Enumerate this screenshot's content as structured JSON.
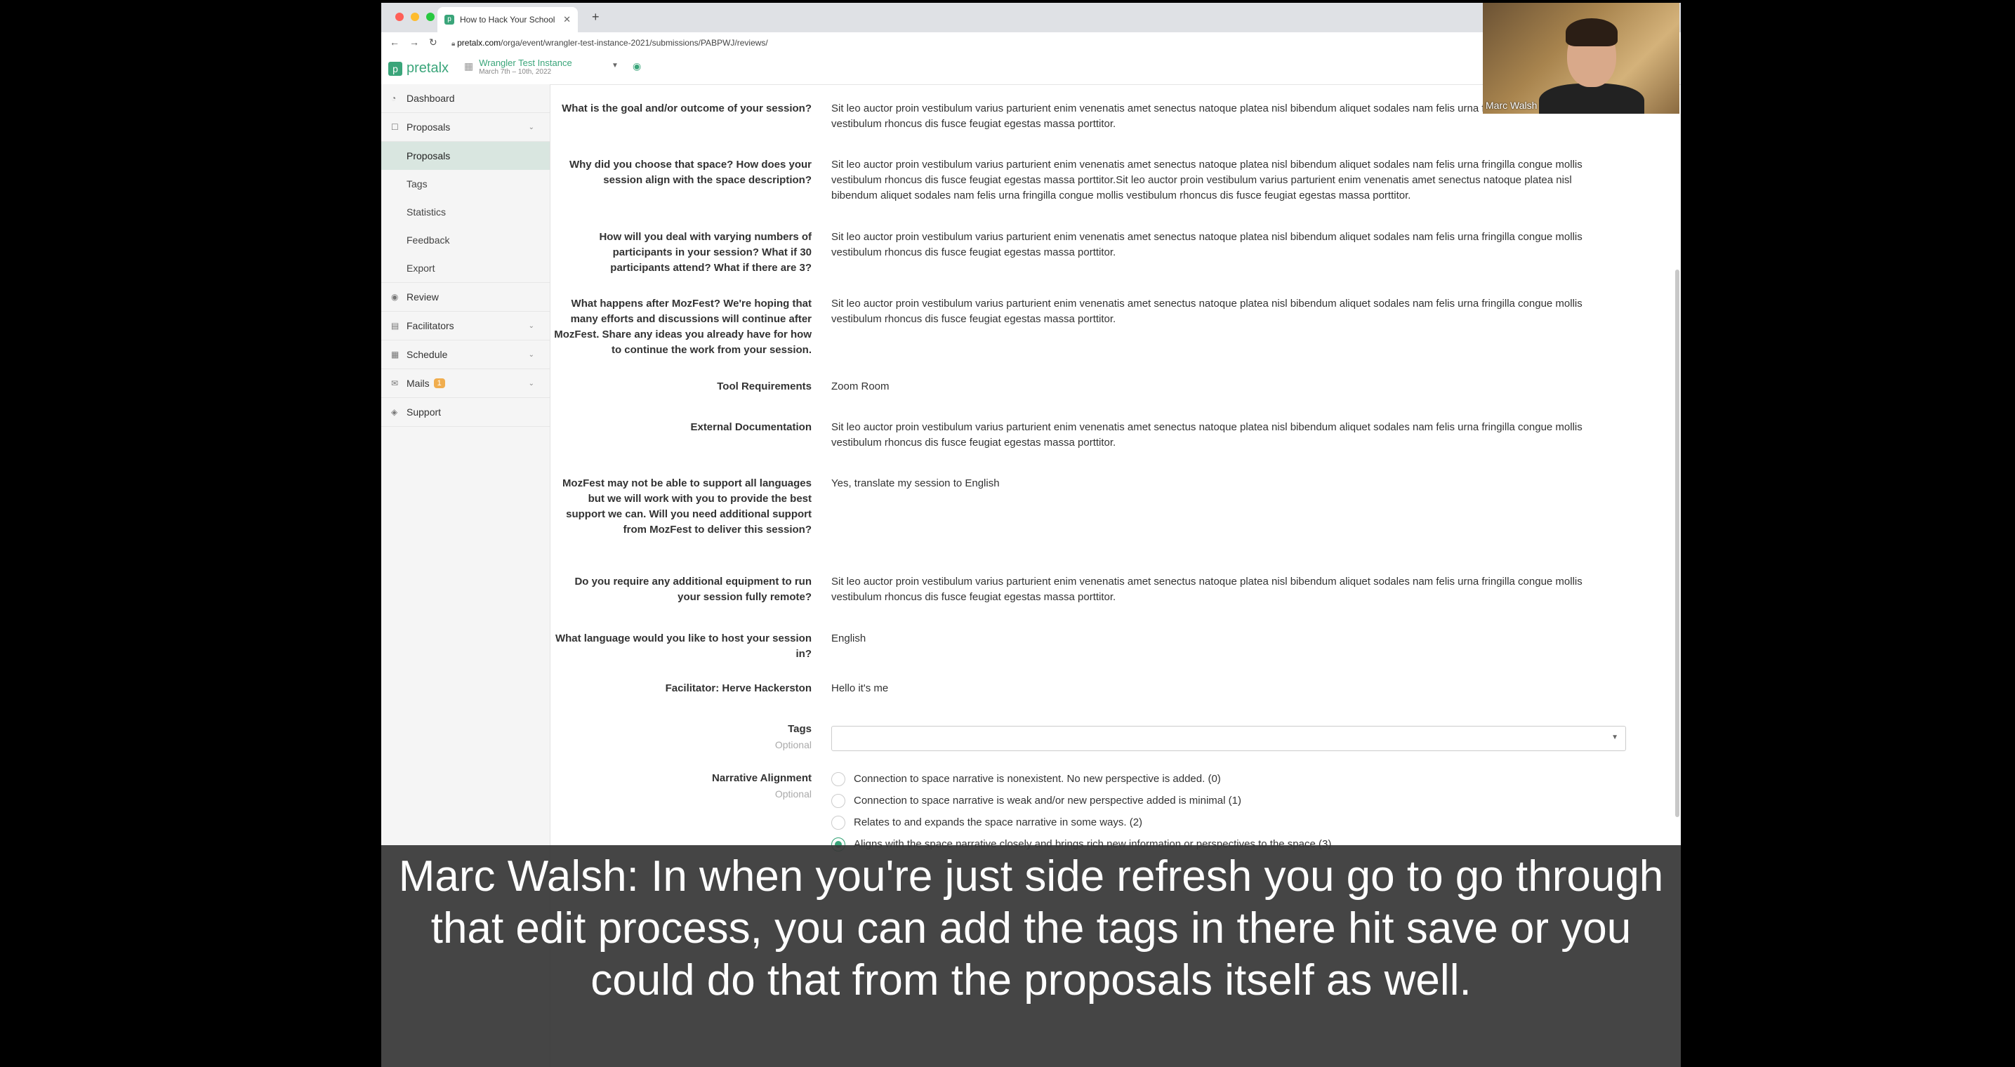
{
  "browser": {
    "tab_title": "How to Hack Your School and",
    "url_host": "pretalx.com",
    "url_path": "/orga/event/wrangler-test-instance-2021/submissions/PABPWJ/reviews/"
  },
  "app": {
    "logo": "pretalx",
    "event_name": "Wrangler Test Instance",
    "event_dates": "March 7th – 10th, 2022"
  },
  "sidebar": {
    "dashboard": "Dashboard",
    "proposals": "Proposals",
    "sub": [
      "Proposals",
      "Tags",
      "Statistics",
      "Feedback",
      "Export"
    ],
    "review": "Review",
    "facilitators": "Facilitators",
    "schedule": "Schedule",
    "mails": "Mails",
    "mails_badge": "1",
    "support": "Support"
  },
  "fields": [
    {
      "q": "What is the goal and/or outcome of your session?",
      "a": "Sit leo auctor proin vestibulum varius parturient enim venenatis amet senectus natoque platea nisl bibendum aliquet sodales nam felis urna fringilla congue mollis vestibulum rhoncus dis fusce feugiat egestas massa porttitor."
    },
    {
      "q": "Why did you choose that space? How does your session align with the space description?",
      "a": "Sit leo auctor proin vestibulum varius parturient enim venenatis amet senectus natoque platea nisl bibendum aliquet sodales nam felis urna fringilla congue mollis vestibulum rhoncus dis fusce feugiat egestas massa porttitor.Sit leo auctor proin vestibulum varius parturient enim venenatis amet senectus natoque platea nisl bibendum aliquet sodales nam felis urna fringilla congue mollis vestibulum rhoncus dis fusce feugiat egestas massa porttitor."
    },
    {
      "q": "How will you deal with varying numbers of participants in your session? What if 30 participants attend? What if there are 3?",
      "a": "Sit leo auctor proin vestibulum varius parturient enim venenatis amet senectus natoque platea nisl bibendum aliquet sodales nam felis urna fringilla congue mollis vestibulum rhoncus dis fusce feugiat egestas massa porttitor."
    },
    {
      "q": "What happens after MozFest? We're hoping that many efforts and discussions will continue after MozFest. Share any ideas you already have for how to continue the work from your session.",
      "a": "Sit leo auctor proin vestibulum varius parturient enim venenatis amet senectus natoque platea nisl bibendum aliquet sodales nam felis urna fringilla congue mollis vestibulum rhoncus dis fusce feugiat egestas massa porttitor."
    },
    {
      "q": "Tool Requirements",
      "a": "Zoom Room"
    },
    {
      "q": "External Documentation",
      "a": "Sit leo auctor proin vestibulum varius parturient enim venenatis amet senectus natoque platea nisl bibendum aliquet sodales nam felis urna fringilla congue mollis vestibulum rhoncus dis fusce feugiat egestas massa porttitor."
    },
    {
      "q": "MozFest may not be able to support all languages but we will work with you to provide the best support we can. Will you need additional support from MozFest to deliver this session?",
      "a": "Yes, translate my session to English"
    },
    {
      "q": "Do you require any additional equipment to run your session fully remote?",
      "a": "Sit leo auctor proin vestibulum varius parturient enim venenatis amet senectus natoque platea nisl bibendum aliquet sodales nam felis urna fringilla congue mollis vestibulum rhoncus dis fusce feugiat egestas massa porttitor."
    },
    {
      "q": "What language would you like to host your session in?",
      "a": "English"
    },
    {
      "q": "Facilitator: Herve Hackerston",
      "a": "Hello it's me"
    }
  ],
  "tags": {
    "label": "Tags",
    "optional": "Optional"
  },
  "narrative": {
    "label": "Narrative Alignment",
    "optional": "Optional",
    "options": [
      "Connection to space narrative is nonexistent. No new perspective is added. (0)",
      "Connection to space narrative is weak and/or new perspective added is minimal (1)",
      "Relates to and expands the space narrative in some ways. (2)",
      "Aligns with the space narrative closely and brings rich new information or perspectives to the space (3)"
    ],
    "selected_index": 3
  },
  "webcam": {
    "name": "Marc Walsh"
  },
  "caption": "Marc Walsh: In when you're just side refresh you go to go through that edit process, you can add the tags in there hit save or you could do that from the proposals itself as well.",
  "colors": {
    "accent": "#3aa57a",
    "badge": "#f0ad4e"
  }
}
